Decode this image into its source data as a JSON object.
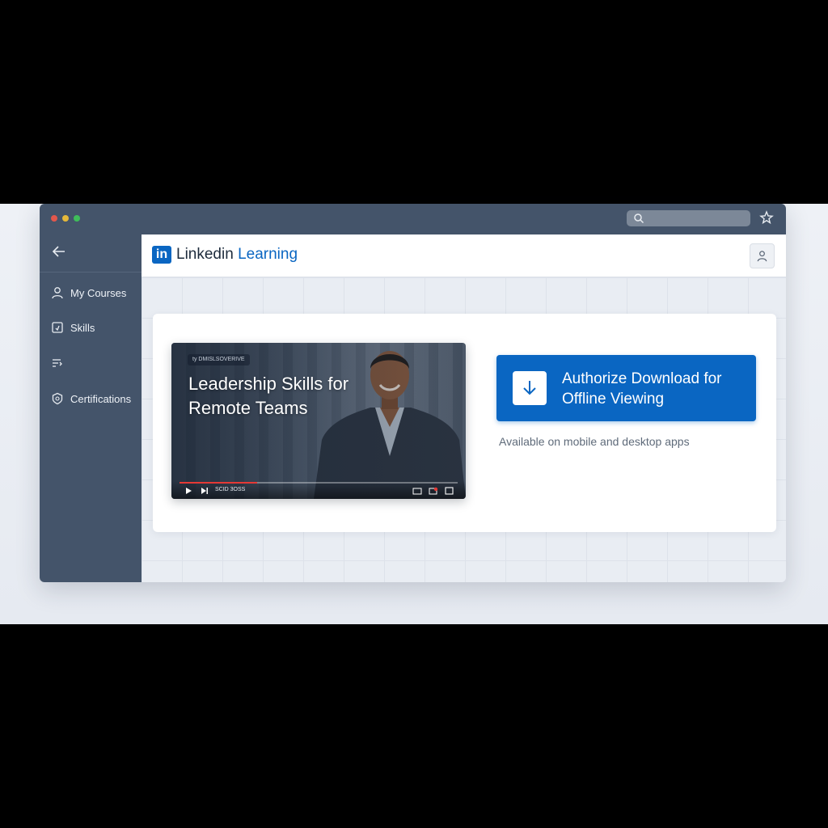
{
  "app": {
    "logo_badge": "in",
    "logo_brand": "Linkedin",
    "logo_product": "Learning"
  },
  "sidebar": {
    "items": [
      {
        "label": "My Courses",
        "icon": "person-icon"
      },
      {
        "label": "Skills",
        "icon": "skills-icon"
      },
      {
        "label": "",
        "icon": "list-icon"
      },
      {
        "label": "Certifications",
        "icon": "badge-icon"
      }
    ]
  },
  "video": {
    "chip_text": "ty  DMISLSOVERIVE",
    "title": "Leadership Skills for Remote Teams",
    "timecode": "SCID 3OSS",
    "progress": 0.28
  },
  "download": {
    "button_label": "Authorize Download for Offline Viewing",
    "availability_note": "Available on mobile and desktop apps"
  },
  "colors": {
    "brand_blue": "#0a66c2",
    "sidebar_bg": "#44546a",
    "progress_red": "#e53935"
  }
}
